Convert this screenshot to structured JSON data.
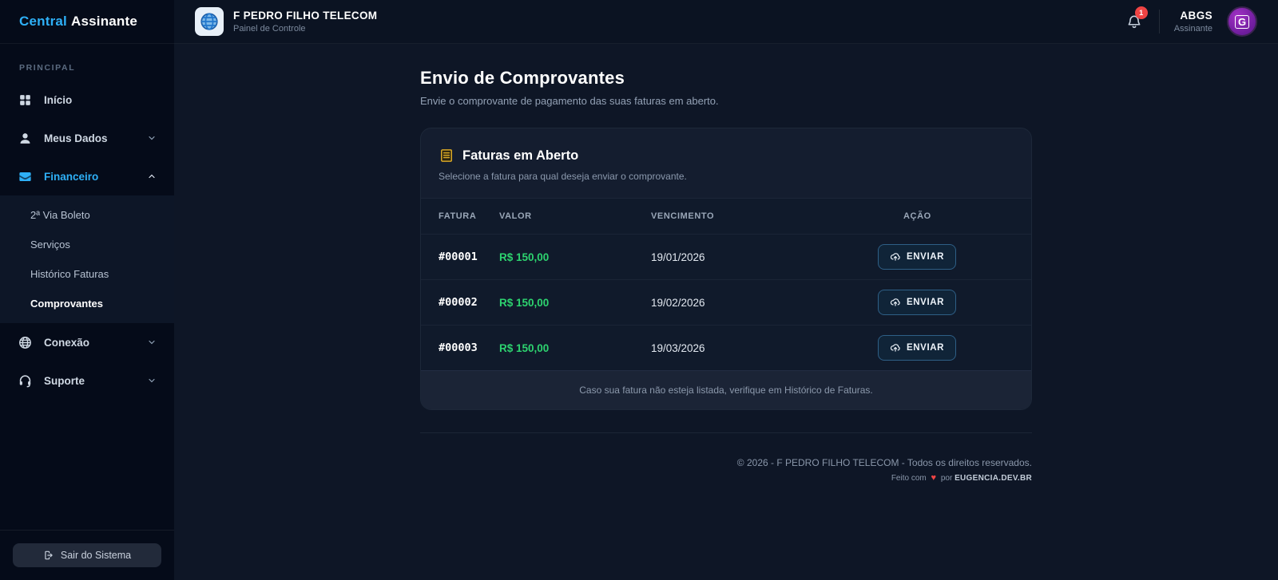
{
  "brand": {
    "primary": "Central",
    "secondary": "Assinante"
  },
  "sidebar": {
    "section_label": "PRINCIPAL",
    "items": {
      "inicio": "Início",
      "meus_dados": "Meus Dados",
      "financeiro": "Financeiro",
      "conexao": "Conexão",
      "suporte": "Suporte"
    },
    "financeiro_submenu": [
      "2ª Via Boleto",
      "Serviços",
      "Histórico Faturas",
      "Comprovantes"
    ],
    "logout_label": "Sair do Sistema"
  },
  "header": {
    "company_name": "F PEDRO FILHO TELECOM",
    "company_subtitle": "Painel de Controle",
    "notification_count": "1",
    "user_name": "ABGS",
    "user_role": "Assinante",
    "avatar_glyph": "G"
  },
  "main": {
    "title": "Envio de Comprovantes",
    "subtitle": "Envie o comprovante de pagamento das suas faturas em aberto.",
    "card": {
      "title": "Faturas em Aberto",
      "subtitle": "Selecione a fatura para qual deseja enviar o comprovante.",
      "columns": [
        "FATURA",
        "VALOR",
        "VENCIMENTO",
        "AÇÃO"
      ],
      "rows": [
        {
          "fatura": "#00001",
          "valor": "R$ 150,00",
          "vencimento": "19/01/2026",
          "action": "ENVIAR"
        },
        {
          "fatura": "#00002",
          "valor": "R$ 150,00",
          "vencimento": "19/02/2026",
          "action": "ENVIAR"
        },
        {
          "fatura": "#00003",
          "valor": "R$ 150,00",
          "vencimento": "19/03/2026",
          "action": "ENVIAR"
        }
      ],
      "footer_note": "Caso sua fatura não esteja listada, verifique em Histórico de Faturas."
    },
    "footer": {
      "copyright": "© 2026 - F PEDRO FILHO TELECOM - Todos os direitos reservados.",
      "made_prefix": "Feito com",
      "made_heart": "♥",
      "made_middle": "por",
      "made_brand": "EUGENCIA.DEV.BR"
    }
  },
  "colors": {
    "accent_blue": "#2eb0f7",
    "money_green": "#2dd36f",
    "badge_red": "#ef4444",
    "receipt_gold": "#d9a826",
    "avatar_purple": "#8e24aa"
  }
}
